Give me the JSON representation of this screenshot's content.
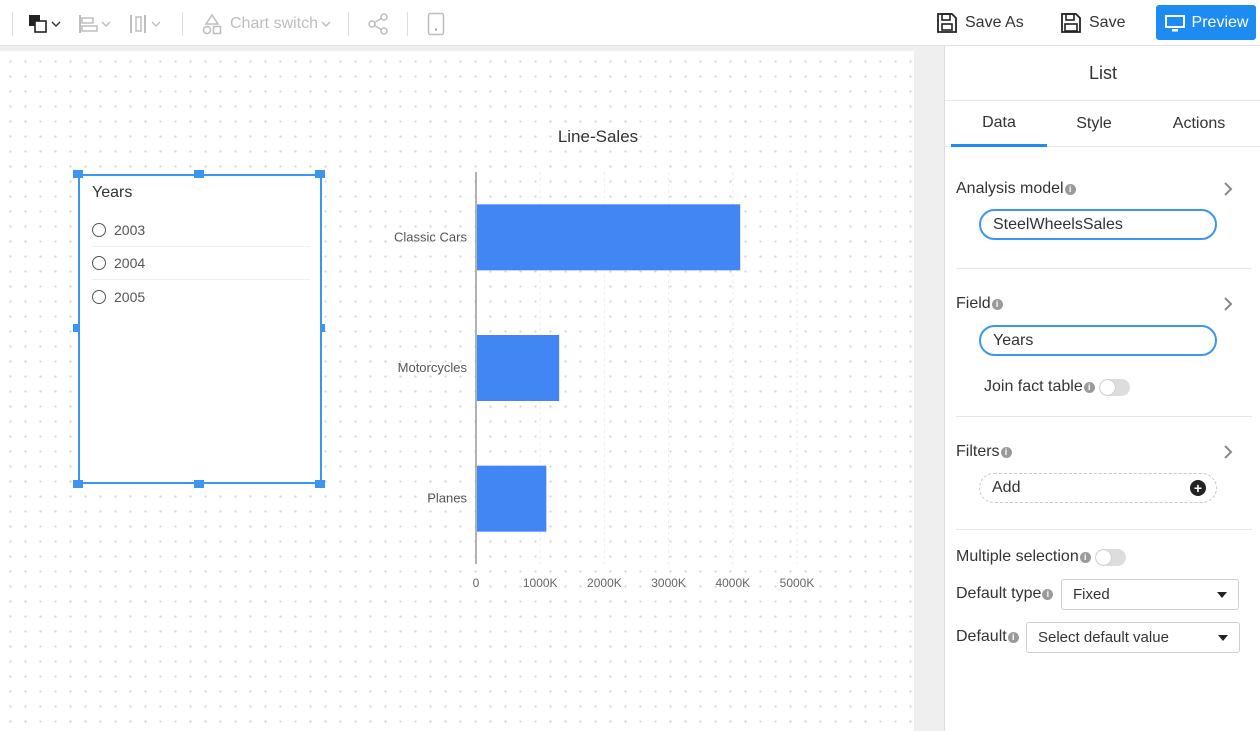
{
  "toolbar": {
    "chart_switch_label": "Chart switch",
    "save_as_label": "Save As",
    "save_label": "Save",
    "preview_label": "Preview"
  },
  "list_widget": {
    "title": "Years",
    "items": [
      "2003",
      "2004",
      "2005"
    ]
  },
  "chart_data": {
    "type": "bar",
    "orientation": "horizontal",
    "title": "Line-Sales",
    "categories": [
      "Classic Cars",
      "Motorcycles",
      "Planes"
    ],
    "values": [
      4100000,
      1280000,
      1080000
    ],
    "xlim": [
      0,
      5000000
    ],
    "x_ticks": [
      "0",
      "1000K",
      "2000K",
      "3000K",
      "4000K",
      "5000K"
    ],
    "bar_color": "#4286f4",
    "grid": true
  },
  "panel": {
    "title": "List",
    "tabs": [
      "Data",
      "Style",
      "Actions"
    ],
    "active_tab": "Data",
    "analysis_model_label": "Analysis model",
    "analysis_model_value": "SteelWheelsSales",
    "field_label": "Field",
    "field_value": "Years",
    "join_fact_table_label": "Join fact table",
    "filters_label": "Filters",
    "add_label": "Add",
    "multiple_selection_label": "Multiple selection",
    "default_type_label": "Default type",
    "default_type_value": "Fixed",
    "default_label": "Default",
    "default_value_placeholder": "Select default value"
  },
  "colors": {
    "accent": "#1c8cf2",
    "selection": "#3c96f0"
  }
}
